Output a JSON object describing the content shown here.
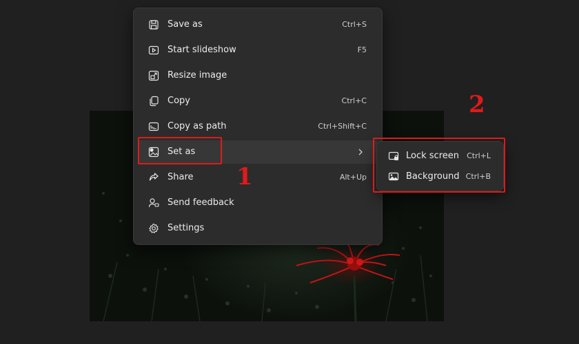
{
  "menu": {
    "items": [
      {
        "label": "Save as",
        "shortcut": "Ctrl+S",
        "icon": "save-icon"
      },
      {
        "label": "Start slideshow",
        "shortcut": "F5",
        "icon": "slideshow-icon"
      },
      {
        "label": "Resize image",
        "shortcut": "",
        "icon": "resize-icon"
      },
      {
        "label": "Copy",
        "shortcut": "Ctrl+C",
        "icon": "copy-icon"
      },
      {
        "label": "Copy as path",
        "shortcut": "Ctrl+Shift+C",
        "icon": "copy-path-icon"
      },
      {
        "label": "Set as",
        "shortcut": "",
        "icon": "set-as-icon"
      },
      {
        "label": "Share",
        "shortcut": "Alt+Up",
        "icon": "share-icon"
      },
      {
        "label": "Send feedback",
        "shortcut": "",
        "icon": "feedback-icon"
      },
      {
        "label": "Settings",
        "shortcut": "",
        "icon": "settings-icon"
      }
    ]
  },
  "submenu": {
    "items": [
      {
        "label": "Lock screen",
        "shortcut": "Ctrl+L",
        "icon": "lock-screen-icon"
      },
      {
        "label": "Background",
        "shortcut": "Ctrl+B",
        "icon": "background-icon"
      }
    ]
  },
  "annotations": {
    "step1": "1",
    "step2": "2",
    "color": "#e01a1a"
  }
}
